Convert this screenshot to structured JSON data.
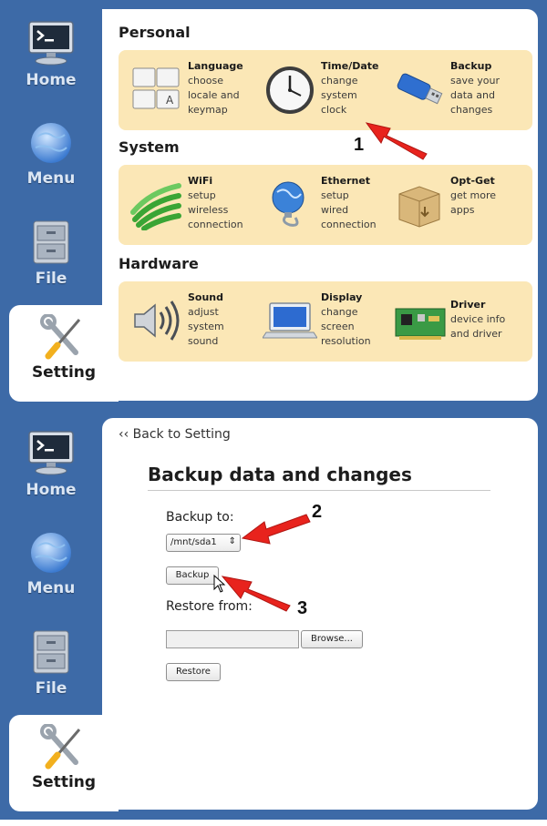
{
  "sidebar": {
    "items": [
      {
        "label": "Home",
        "icon": "monitor-terminal-icon"
      },
      {
        "label": "Menu",
        "icon": "globe-icon"
      },
      {
        "label": "File",
        "icon": "file-cabinet-icon"
      },
      {
        "label": "Setting",
        "icon": "wrench-screwdriver-icon",
        "active": true
      }
    ]
  },
  "settings": {
    "sections": [
      {
        "title": "Personal",
        "tiles": [
          {
            "title": "Language",
            "desc": "choose\nlocale and\nkeymap",
            "icon": "keyboard-keys-icon"
          },
          {
            "title": "Time/Date",
            "desc": "change\nsystem\nclock",
            "icon": "clock-icon"
          },
          {
            "title": "Backup",
            "desc": "save your\ndata and\nchanges",
            "icon": "usb-drive-icon"
          }
        ]
      },
      {
        "title": "System",
        "tiles": [
          {
            "title": "WiFi",
            "desc": "setup\nwireless\nconnection",
            "icon": "wifi-signal-icon"
          },
          {
            "title": "Ethernet",
            "desc": "setup\nwired\nconnection",
            "icon": "ethernet-globe-icon"
          },
          {
            "title": "Opt-Get",
            "desc": "get more\napps",
            "icon": "package-box-icon"
          }
        ]
      },
      {
        "title": "Hardware",
        "tiles": [
          {
            "title": "Sound",
            "desc": "adjust\nsystem\nsound",
            "icon": "speaker-icon"
          },
          {
            "title": "Display",
            "desc": "change\nscreen\nresolution",
            "icon": "laptop-display-icon"
          },
          {
            "title": "Driver",
            "desc": "device info\nand driver",
            "icon": "circuit-board-icon"
          }
        ]
      }
    ]
  },
  "backup_page": {
    "back_link": "‹‹ Back to Setting",
    "title": "Backup data and changes",
    "backup_to_label": "Backup to:",
    "device_selected": "/mnt/sda1",
    "backup_button": "Backup",
    "restore_from_label": "Restore from:",
    "restore_path_value": "",
    "browse_button": "Browse...",
    "restore_button": "Restore"
  },
  "annotations": {
    "step1": "1",
    "step2": "2",
    "step3": "3"
  },
  "colors": {
    "sidebar_blue": "#3d6aa7",
    "group_bg": "#fbe7b6",
    "arrow_red": "#e8231d"
  }
}
